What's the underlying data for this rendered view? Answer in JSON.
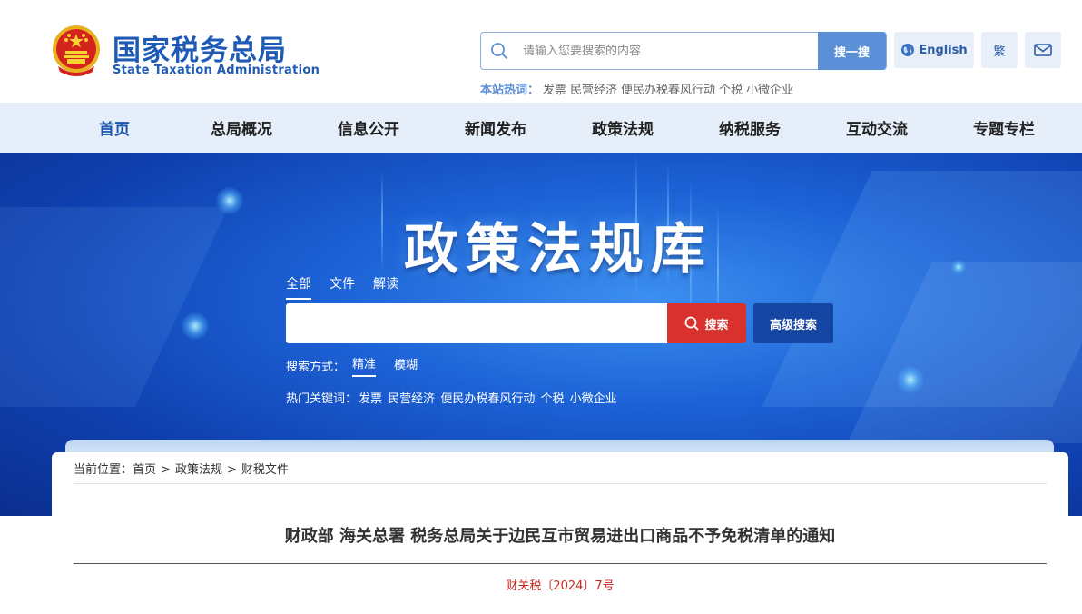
{
  "header": {
    "logo_cn": "国家税务总局",
    "logo_en": "State Taxation Administration",
    "search_placeholder": "请输入您要搜索的内容",
    "search_button": "搜一搜",
    "english_button": "English",
    "traditional_button": "繁",
    "hot_label": "本站热词：",
    "hot_words": [
      "发票",
      "民营经济",
      "便民办税春风行动",
      "个税",
      "小微企业"
    ]
  },
  "nav": {
    "items": [
      "首页",
      "总局概况",
      "信息公开",
      "新闻发布",
      "政策法规",
      "纳税服务",
      "互动交流",
      "专题专栏"
    ]
  },
  "banner": {
    "title": "政策法规库",
    "tabs": [
      "全部",
      "文件",
      "解读"
    ],
    "search_button": "搜索",
    "advanced_button": "高级搜索",
    "mode_label": "搜索方式：",
    "modes": [
      "精准",
      "模糊"
    ],
    "hot_label": "热门关键词：",
    "hot_words": [
      "发票",
      "民营经济",
      "便民办税春风行动",
      "个税",
      "小微企业"
    ]
  },
  "breadcrumb": {
    "label": "当前位置：",
    "items": [
      "首页",
      "政策法规",
      "财税文件"
    ],
    "separator": ">"
  },
  "document": {
    "title": "财政部 海关总署 税务总局关于边民互市贸易进出口商品不予免税清单的通知",
    "number": "财关税〔2024〕7号"
  },
  "colors": {
    "brand_blue": "#1f5bb5",
    "nav_bg": "#e6eef9",
    "search_red": "#d9322e",
    "advanced_blue": "#1646a3",
    "doc_number_red": "#c8261f"
  },
  "icons": {
    "emblem": "national-emblem-icon",
    "search": "search-icon",
    "globe": "globe-icon",
    "mail": "mail-icon"
  }
}
